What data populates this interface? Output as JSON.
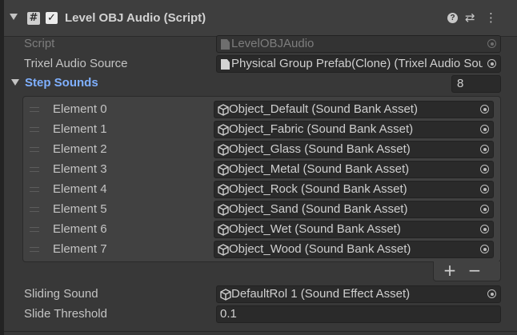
{
  "component": {
    "title": "Level OBJ Audio (Script)",
    "enabled": "✓",
    "icons": {
      "script": "#",
      "help": "?",
      "preset": "⇄",
      "menu": "⋮"
    }
  },
  "script_field": {
    "label": "Script",
    "value": "LevelOBJAudio"
  },
  "trixel_source": {
    "label": "Trixel Audio Source",
    "value": "Physical Group Prefab(Clone) (Trixel Audio Source)"
  },
  "step_sounds": {
    "label": "Step Sounds",
    "size": "8",
    "elements": [
      {
        "label": "Element 0",
        "value": "Object_Default (Sound Bank Asset)"
      },
      {
        "label": "Element 1",
        "value": "Object_Fabric (Sound Bank Asset)"
      },
      {
        "label": "Element 2",
        "value": "Object_Glass (Sound Bank Asset)"
      },
      {
        "label": "Element 3",
        "value": "Object_Metal (Sound Bank Asset)"
      },
      {
        "label": "Element 4",
        "value": "Object_Rock (Sound Bank Asset)"
      },
      {
        "label": "Element 5",
        "value": "Object_Sand (Sound Bank Asset)"
      },
      {
        "label": "Element 6",
        "value": "Object_Wet (Sound Bank Asset)"
      },
      {
        "label": "Element 7",
        "value": "Object_Wood (Sound Bank Asset)"
      }
    ],
    "add_label": "+",
    "remove_label": "−"
  },
  "sliding_sound": {
    "label": "Sliding Sound",
    "value": "DefaultRol 1 (Sound Effect Asset)"
  },
  "slide_threshold": {
    "label": "Slide Threshold",
    "value": "0.1"
  }
}
